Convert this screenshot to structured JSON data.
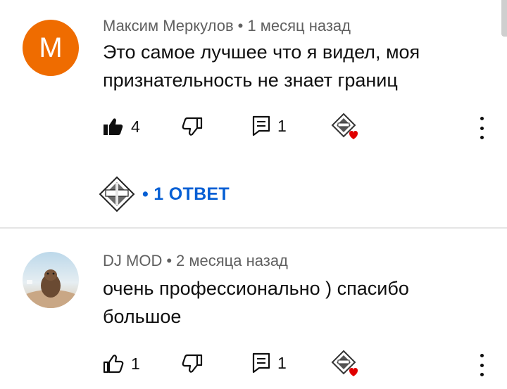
{
  "comments": [
    {
      "avatar_letter": "M",
      "avatar_color": "#ef6c00",
      "author": "Максим Меркулов",
      "separator": "•",
      "time": "1 месяц назад",
      "text_lines": [
        "Это самое лучшее что я видел, моя",
        "признательность не знает границ"
      ],
      "likes": "4",
      "replies_count": "1",
      "like_filled": true,
      "creator_heart": true,
      "replies_label": "• 1 ОТВЕТ"
    },
    {
      "author": "DJ MOD",
      "separator": "•",
      "time": "2 месяца назад",
      "text_lines": [
        "очень профессионально ) спасибо",
        "большое"
      ],
      "likes": "1",
      "replies_count": "1",
      "like_filled": false,
      "creator_heart": true
    }
  ],
  "colors": {
    "link_blue": "#065fd4",
    "heart_red": "#e00000",
    "meta_gray": "#606060"
  },
  "icons": [
    "like-icon",
    "dislike-icon",
    "reply-icon",
    "creator-heart-icon",
    "more-vert-icon"
  ]
}
